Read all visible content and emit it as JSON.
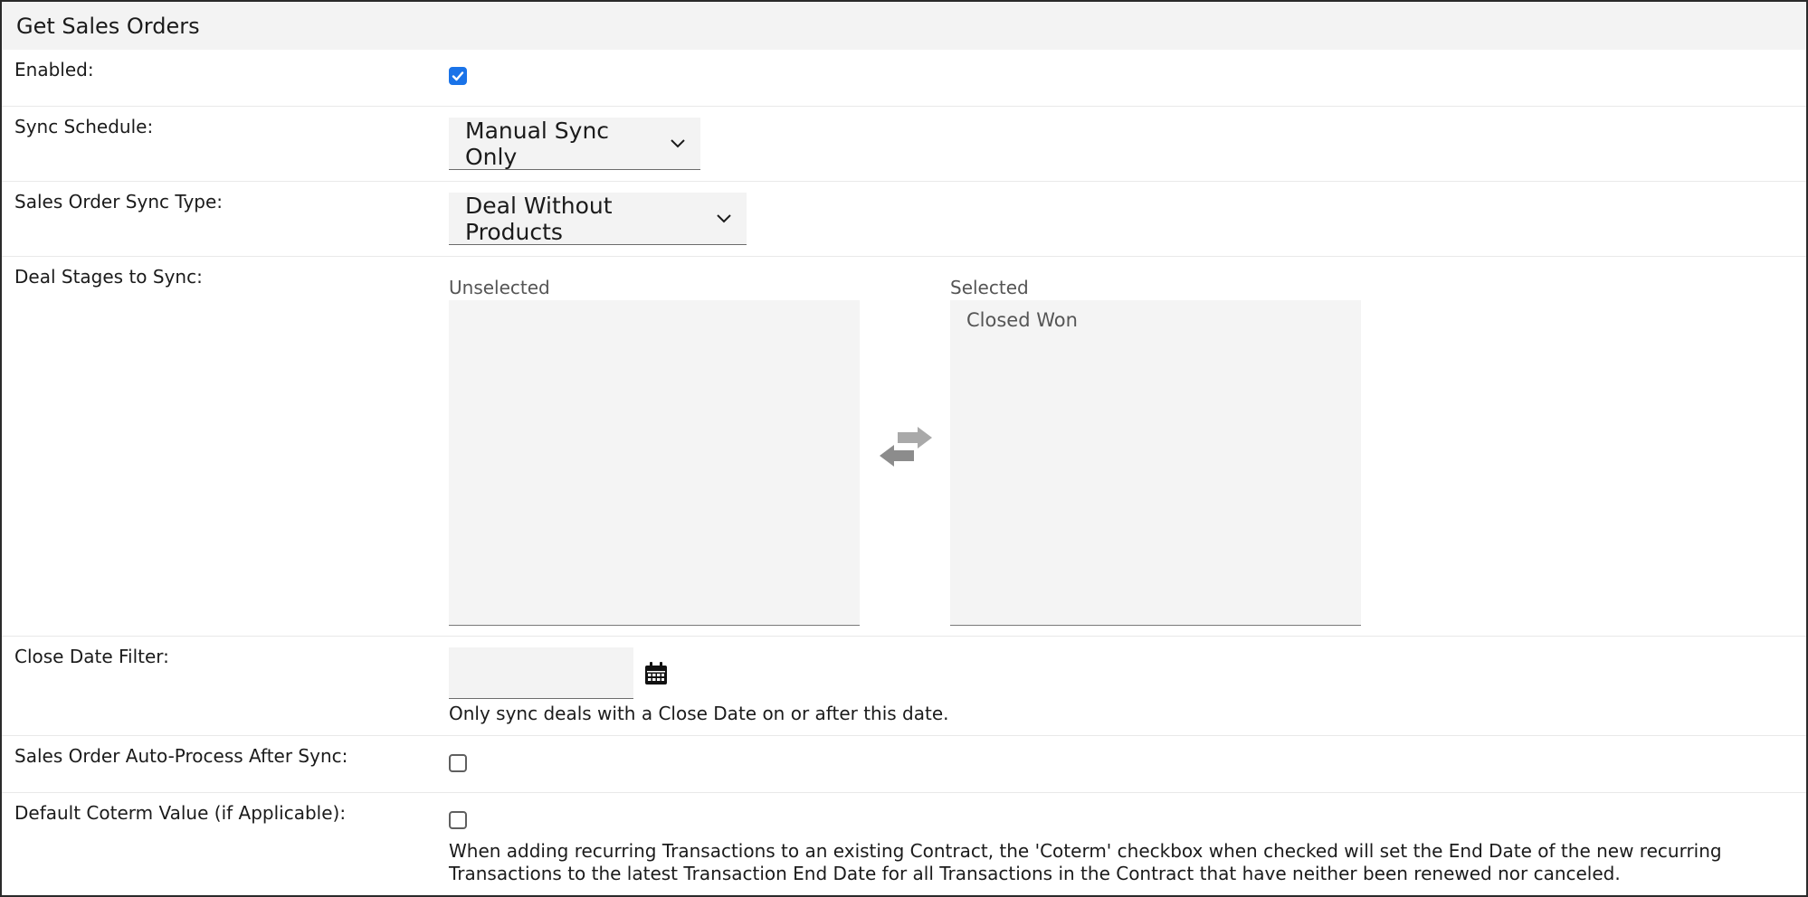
{
  "section": {
    "title": "Get Sales Orders"
  },
  "fields": {
    "enabled": {
      "label": "Enabled:",
      "checked": true
    },
    "sync_schedule": {
      "label": "Sync Schedule:",
      "value": "Manual Sync Only"
    },
    "sync_type": {
      "label": "Sales Order Sync Type:",
      "value": "Deal Without Products"
    },
    "deal_stages": {
      "label": "Deal Stages to Sync:",
      "unselected_label": "Unselected",
      "selected_label": "Selected",
      "unselected_items": [],
      "selected_items": [
        "Closed Won"
      ]
    },
    "close_date": {
      "label": "Close Date Filter:",
      "value": "",
      "hint": "Only sync deals with a Close Date on or after this date."
    },
    "auto_process": {
      "label": "Sales Order Auto-Process After Sync:",
      "checked": false
    },
    "coterm": {
      "label": "Default Coterm Value (if Applicable):",
      "checked": false,
      "hint_line1": "When adding recurring Transactions to an existing Contract, the 'Coterm' checkbox when checked will set the End Date of the new recurring",
      "hint_line2": "Transactions to the latest Transaction End Date for all Transactions in the Contract that have neither been renewed nor canceled."
    }
  },
  "icons": {
    "swap": "swap-arrows-icon",
    "calendar": "calendar-icon",
    "chevron": "chevron-down-icon",
    "check": "checkmark-icon"
  },
  "colors": {
    "accent": "#1a73e8",
    "header_bg": "#f3f3f3",
    "field_bg": "#f3f3f3"
  }
}
